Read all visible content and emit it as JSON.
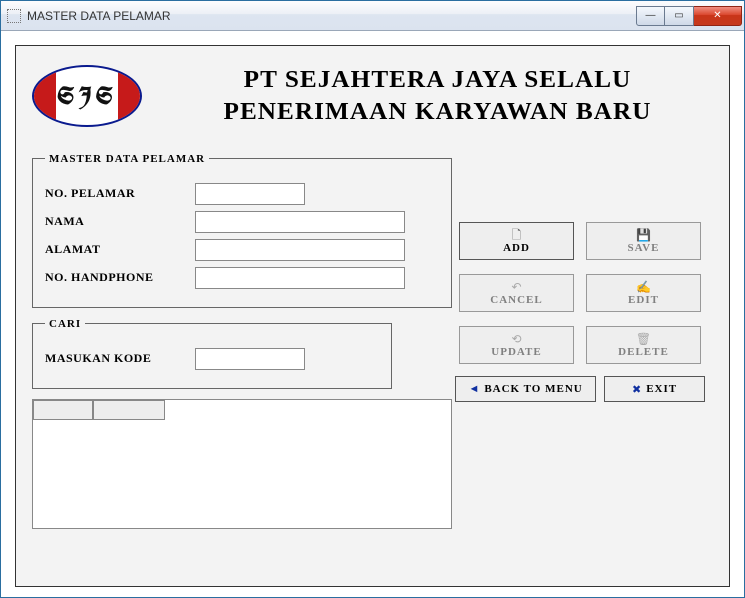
{
  "window": {
    "title": "MASTER DATA PELAMAR"
  },
  "company": {
    "logo_text": "SJS",
    "line1": "PT SEJAHTERA JAYA SELALU",
    "line2": "PENERIMAAN KARYAWAN BARU"
  },
  "groupbox": {
    "master_legend": "MASTER DATA PELAMAR",
    "cari_legend": "CARI"
  },
  "fields": {
    "no_pelamar": {
      "label": "NO. PELAMAR",
      "value": ""
    },
    "nama": {
      "label": "NAMA",
      "value": ""
    },
    "alamat": {
      "label": "ALAMAT",
      "value": ""
    },
    "no_handphone": {
      "label": "NO. HANDPHONE",
      "value": ""
    },
    "masukan_kode": {
      "label": "MASUKAN KODE",
      "value": ""
    }
  },
  "buttons": {
    "add": "ADD",
    "save": "SAVE",
    "cancel": "CANCEL",
    "edit": "EDIT",
    "update": "UPDATE",
    "delete": "DELETE",
    "back": "BACK TO MENU",
    "exit": "EXIT"
  },
  "icons": {
    "add": "🗋",
    "save": "💾",
    "cancel": "↶",
    "edit": "✍",
    "update": "⟲",
    "delete": "🗑",
    "back": "◄",
    "exit": "✖"
  },
  "button_state": {
    "add": true,
    "save": false,
    "cancel": false,
    "edit": false,
    "update": false,
    "delete": false,
    "back": true,
    "exit": true
  }
}
